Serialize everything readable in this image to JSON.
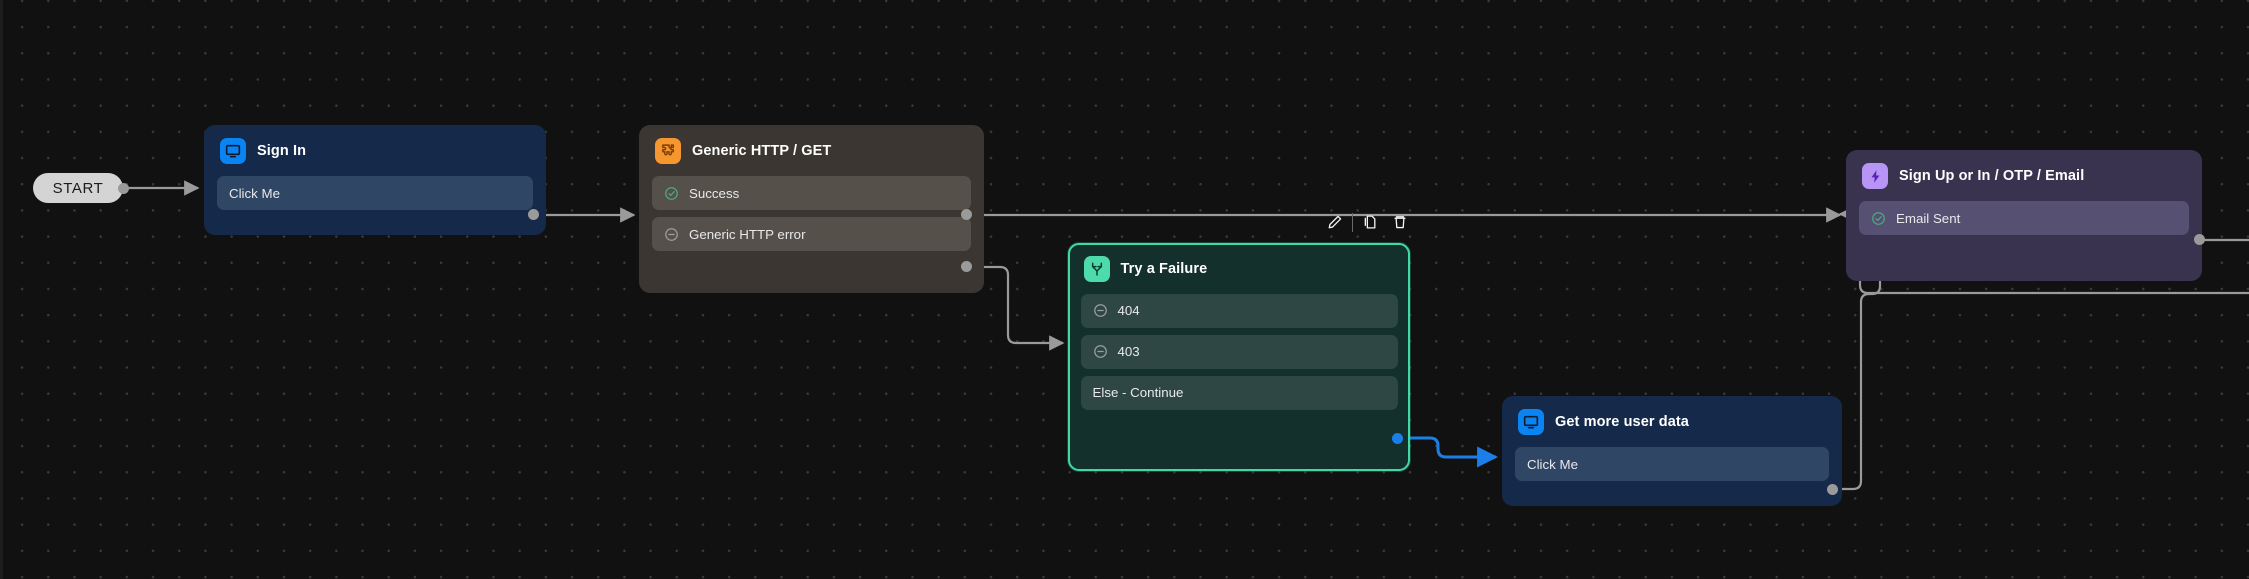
{
  "canvas": {
    "background_color": "#111112",
    "grid": "dot-grid"
  },
  "start": {
    "label": "START"
  },
  "selection_toolbar": {
    "buttons": [
      {
        "name": "edit-button",
        "icon": "pencil-icon",
        "label": "Edit"
      },
      {
        "name": "duplicate-button",
        "icon": "copy-icon",
        "label": "Duplicate"
      },
      {
        "name": "delete-button",
        "icon": "trash-icon",
        "label": "Delete"
      }
    ]
  },
  "nodes": [
    {
      "id": "sign-in",
      "title": "Sign In",
      "icon": "screen-icon",
      "icon_color": "#0b84f3",
      "color": "#152a4a",
      "selected": false,
      "ports": [
        {
          "label": "Click Me",
          "glyph": "none"
        }
      ]
    },
    {
      "id": "generic-http-get",
      "title": "Generic HTTP / GET",
      "icon": "puzzle-piece-icon",
      "icon_color": "#f5962e",
      "color": "#3b3631",
      "selected": false,
      "ports": [
        {
          "label": "Success",
          "glyph": "check-circle-icon"
        },
        {
          "label": "Generic HTTP error",
          "glyph": "minus-circle-icon"
        }
      ]
    },
    {
      "id": "try-a-failure",
      "title": "Try a Failure",
      "icon": "branch-icon",
      "icon_color": "#4ddbab",
      "color": "#13302d",
      "selected": true,
      "ports": [
        {
          "label": "404",
          "glyph": "minus-circle-icon"
        },
        {
          "label": "403",
          "glyph": "minus-circle-icon"
        },
        {
          "label": "Else - Continue",
          "glyph": "none"
        }
      ]
    },
    {
      "id": "get-more-user-data",
      "title": "Get more user data",
      "icon": "screen-icon",
      "icon_color": "#0b84f3",
      "color": "#152a4a",
      "selected": false,
      "ports": [
        {
          "label": "Click Me",
          "glyph": "none"
        }
      ]
    },
    {
      "id": "sign-up-or-in",
      "title": "Sign Up or In / OTP / Email",
      "icon": "lightning-bolt-icon",
      "icon_color": "#b795f5",
      "color": "#393350",
      "selected": false,
      "ports": [
        {
          "label": "Email Sent",
          "glyph": "check-circle-icon"
        }
      ]
    }
  ],
  "edges": [
    {
      "from": "start",
      "to": "sign-in",
      "highlighted": false
    },
    {
      "from": "sign-in.Click Me",
      "to": "generic-http-get",
      "highlighted": false
    },
    {
      "from": "generic-http-get.Success",
      "to": "sign-up-or-in",
      "highlighted": false
    },
    {
      "from": "generic-http-get.Generic HTTP error",
      "to": "try-a-failure",
      "highlighted": false
    },
    {
      "from": "try-a-failure.Else - Continue",
      "to": "get-more-user-data",
      "highlighted": true
    },
    {
      "from": "get-more-user-data.Click Me",
      "to": "sign-up-or-in",
      "highlighted": false
    },
    {
      "from": "sign-up-or-in.Email Sent",
      "to": "offscreen",
      "highlighted": false
    }
  ],
  "colors": {
    "edge": "#9a9a9a",
    "edge_selected": "#1a7fe8",
    "selection_border": "#3fd9a4"
  }
}
